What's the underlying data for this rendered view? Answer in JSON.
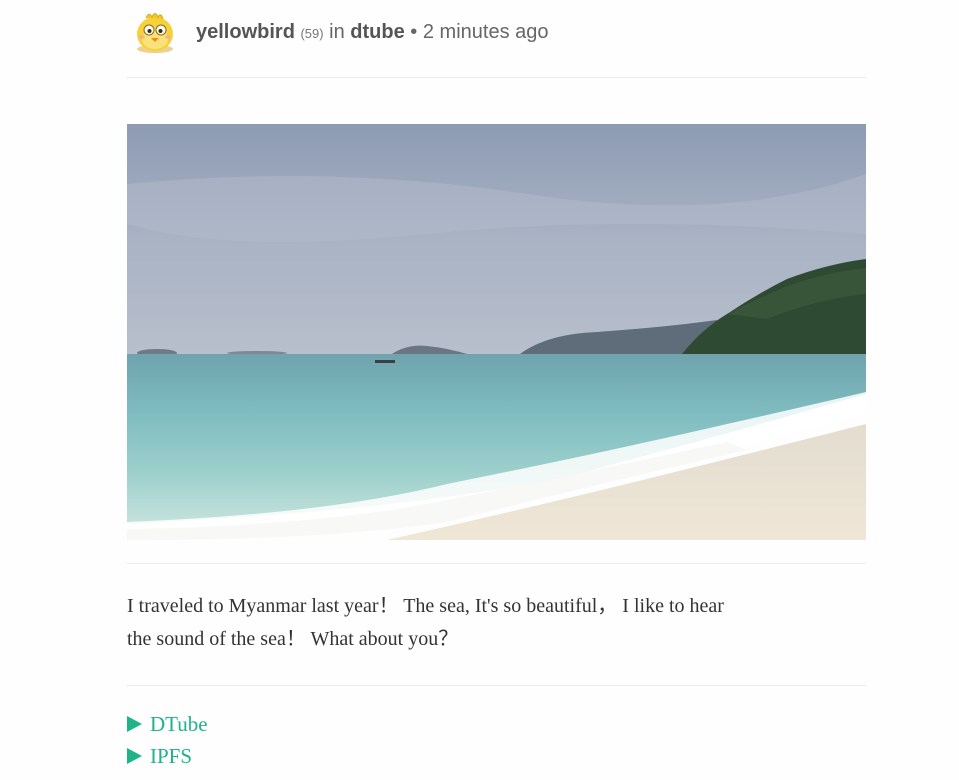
{
  "post": {
    "author": "yellowbird",
    "reputation": "(59)",
    "in_label": "in",
    "community": "dtube",
    "separator": "•",
    "time_ago": "2 minutes ago",
    "avatar_icon": "yellow-bird-icon",
    "image_icon": "beach-photo",
    "body_line_1": "I traveled to Myanmar last year！ The sea, It's so beautiful， I like to hear",
    "body_line_2": "the sound of the sea！ What about you？"
  },
  "links": [
    {
      "label": "DTube",
      "icon": "play-triangle-icon"
    },
    {
      "label": "IPFS",
      "icon": "play-triangle-icon"
    }
  ],
  "colors": {
    "link": "#1fb38a",
    "text": "#333333",
    "meta": "#666666"
  }
}
